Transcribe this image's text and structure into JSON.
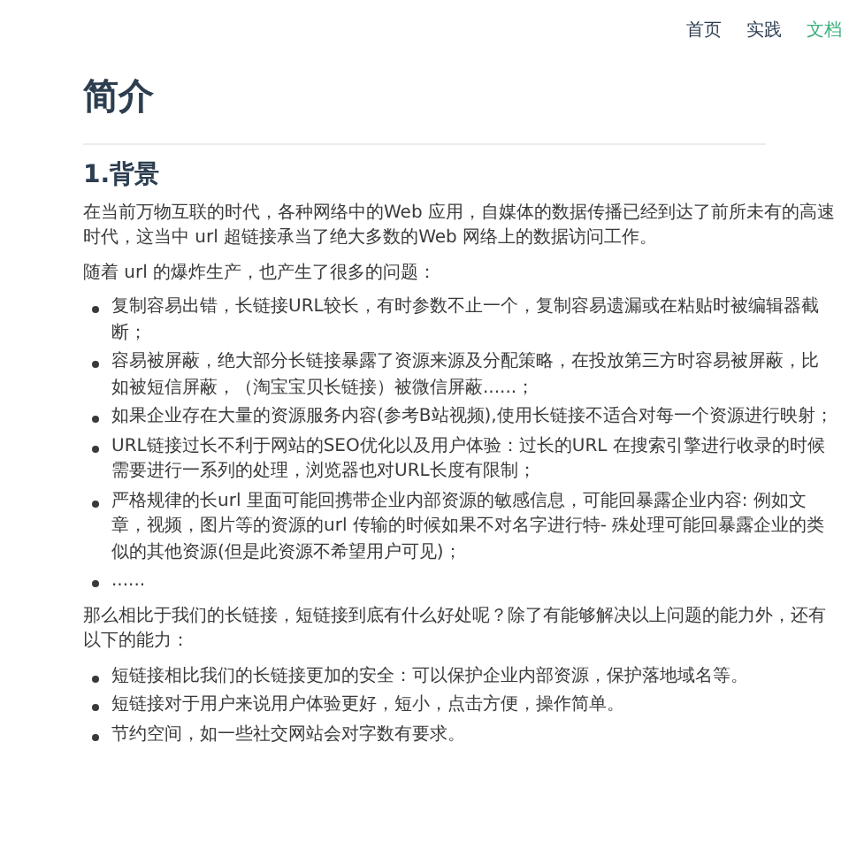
{
  "nav": [
    {
      "label": "首页",
      "selected": false
    },
    {
      "label": "实践",
      "selected": false
    },
    {
      "label": "文档",
      "selected": true
    }
  ],
  "title": "简介",
  "section": {
    "heading": "1.背景",
    "paragraphs_before": [
      "在当前万物互联的时代，各种网络中的Web 应用，自媒体的数据传播已经到达了前所未有的高速时代，这当中 url 超链接承当了绝大多数的Web 网络上的数据访问工作。",
      "随着 url 的爆炸生产，也产生了很多的问题："
    ],
    "problems": [
      "复制容易出错，长链接URL较长，有时参数不止一个，复制容易遗漏或在粘贴时被编辑器截断；",
      "容易被屏蔽，绝大部分长链接暴露了资源来源及分配策略，在投放第三方时容易被屏蔽，比如被短信屏蔽，（淘宝宝贝长链接）被微信屏蔽......；",
      "如果企业存在大量的资源服务内容(参考B站视频),使用长链接不适合对每一个资源进行映射；",
      "URL链接过长不利于网站的SEO优化以及用户体验：过长的URL 在搜索引擎进行收录的时候需要进行一系列的处理，浏览器也对URL长度有限制；",
      "严格规律的长url 里面可能回携带企业内部资源的敏感信息，可能回暴露企业内容: 例如文章，视频，图片等的资源的url 传输的时候如果不对名字进行特- 殊处理可能回暴露企业的类似的其他资源(但是此资源不希望用户可见)；",
      "......"
    ],
    "paragraph_after": "那么相比于我们的长链接，短链接到底有什么好处呢？除了有能够解决以上问题的能力外，还有以下的能力：",
    "benefits": [
      "短链接相比我们的长链接更加的安全：可以保护企业内部资源，保护落地域名等。",
      "短链接对于用户来说用户体验更好，短小，点击方便，操作简单。",
      "节约空间，如一些社交网站会对字数有要求。"
    ]
  }
}
